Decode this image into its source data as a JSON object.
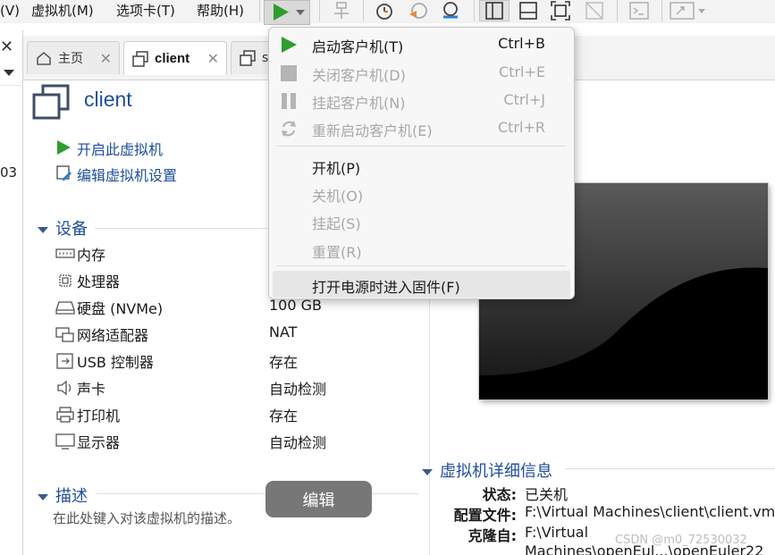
{
  "menubar": {
    "items": [
      "(V)",
      "虚拟机(M)",
      "选项卡(T)",
      "帮助(H)"
    ]
  },
  "tabs": [
    {
      "label": "主页"
    },
    {
      "label": "client"
    },
    {
      "label": "s"
    }
  ],
  "left_strip": {
    "fragment": "03"
  },
  "vm": {
    "name": "client",
    "actions": [
      "开启此虚拟机",
      "编辑虚拟机设置"
    ]
  },
  "devices": {
    "heading": "设备",
    "rows": [
      {
        "name": "内存",
        "value": ""
      },
      {
        "name": "处理器",
        "value": ""
      },
      {
        "name": "硬盘 (NVMe)",
        "value": "100 GB"
      },
      {
        "name": "网络适配器",
        "value": "NAT"
      },
      {
        "name": "USB 控制器",
        "value": "存在"
      },
      {
        "name": "声卡",
        "value": "自动检测"
      },
      {
        "name": "打印机",
        "value": "存在"
      },
      {
        "name": "显示器",
        "value": "自动检测"
      }
    ]
  },
  "description": {
    "heading": "描述",
    "hint": "在此处键入对该虚拟机的描述。",
    "edit_button": "编辑"
  },
  "details": {
    "heading": "虚拟机详细信息",
    "rows": [
      {
        "key": "状态:",
        "value": "已关机"
      },
      {
        "key": "配置文件:",
        "value": "F:\\Virtual Machines\\client\\client.vm"
      },
      {
        "key": "克隆自:",
        "value": "F:\\Virtual"
      },
      {
        "key": "",
        "value": "Machines\\openEul...\\openEuler22"
      }
    ]
  },
  "power_menu": {
    "items": [
      {
        "label": "启动客户机(T)",
        "shortcut": "Ctrl+B",
        "enabled": true,
        "icon": "play-icon"
      },
      {
        "label": "关闭客户机(D)",
        "shortcut": "Ctrl+E",
        "enabled": false,
        "icon": "stop-icon"
      },
      {
        "label": "挂起客户机(N)",
        "shortcut": "Ctrl+J",
        "enabled": false,
        "icon": "pause-icon"
      },
      {
        "label": "重新启动客户机(E)",
        "shortcut": "Ctrl+R",
        "enabled": false,
        "icon": "restart-icon"
      },
      {
        "label": "开机(P)",
        "shortcut": "",
        "enabled": true,
        "icon": ""
      },
      {
        "label": "关机(O)",
        "shortcut": "",
        "enabled": false,
        "icon": ""
      },
      {
        "label": "挂起(S)",
        "shortcut": "",
        "enabled": false,
        "icon": ""
      },
      {
        "label": "重置(R)",
        "shortcut": "",
        "enabled": false,
        "icon": ""
      },
      {
        "label": "打开电源时进入固件(F)",
        "shortcut": "",
        "enabled": true,
        "icon": ""
      }
    ]
  },
  "watermark": "CSDN @m0_72530032",
  "colors": {
    "accent_blue": "#1f4e9c",
    "play_green": "#2e9e2e",
    "disabled_gray": "#a8a8a8"
  }
}
